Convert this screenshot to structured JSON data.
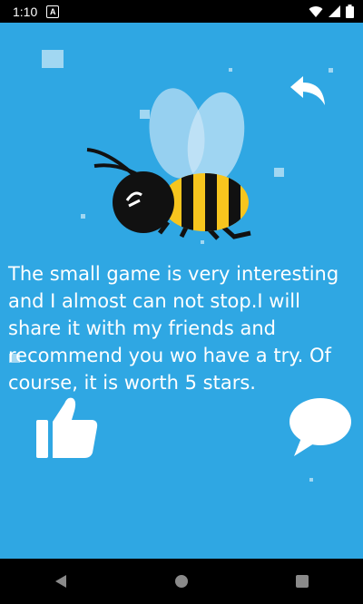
{
  "status_bar": {
    "time": "1:10",
    "notification_badge": "A",
    "icons": [
      "wifi-icon",
      "signal-icon",
      "battery-icon"
    ]
  },
  "review": {
    "text": "The small game is very interesting and I almost can not stop.I will share it with my friends and recommend you wo have a try. Of course, it is worth 5 stars."
  },
  "actions": {
    "back_icon": "undo-arrow-icon",
    "like_icon": "thumbs-up-icon",
    "comment_icon": "chat-bubble-icon"
  },
  "nav_bar": {
    "icons": [
      "back-triangle-icon",
      "home-circle-icon",
      "recents-square-icon"
    ]
  },
  "colors": {
    "background": "#2fa7e3",
    "bee_yellow": "#f7c51e",
    "bee_black": "#111111",
    "wing": "#9fd3f2"
  }
}
